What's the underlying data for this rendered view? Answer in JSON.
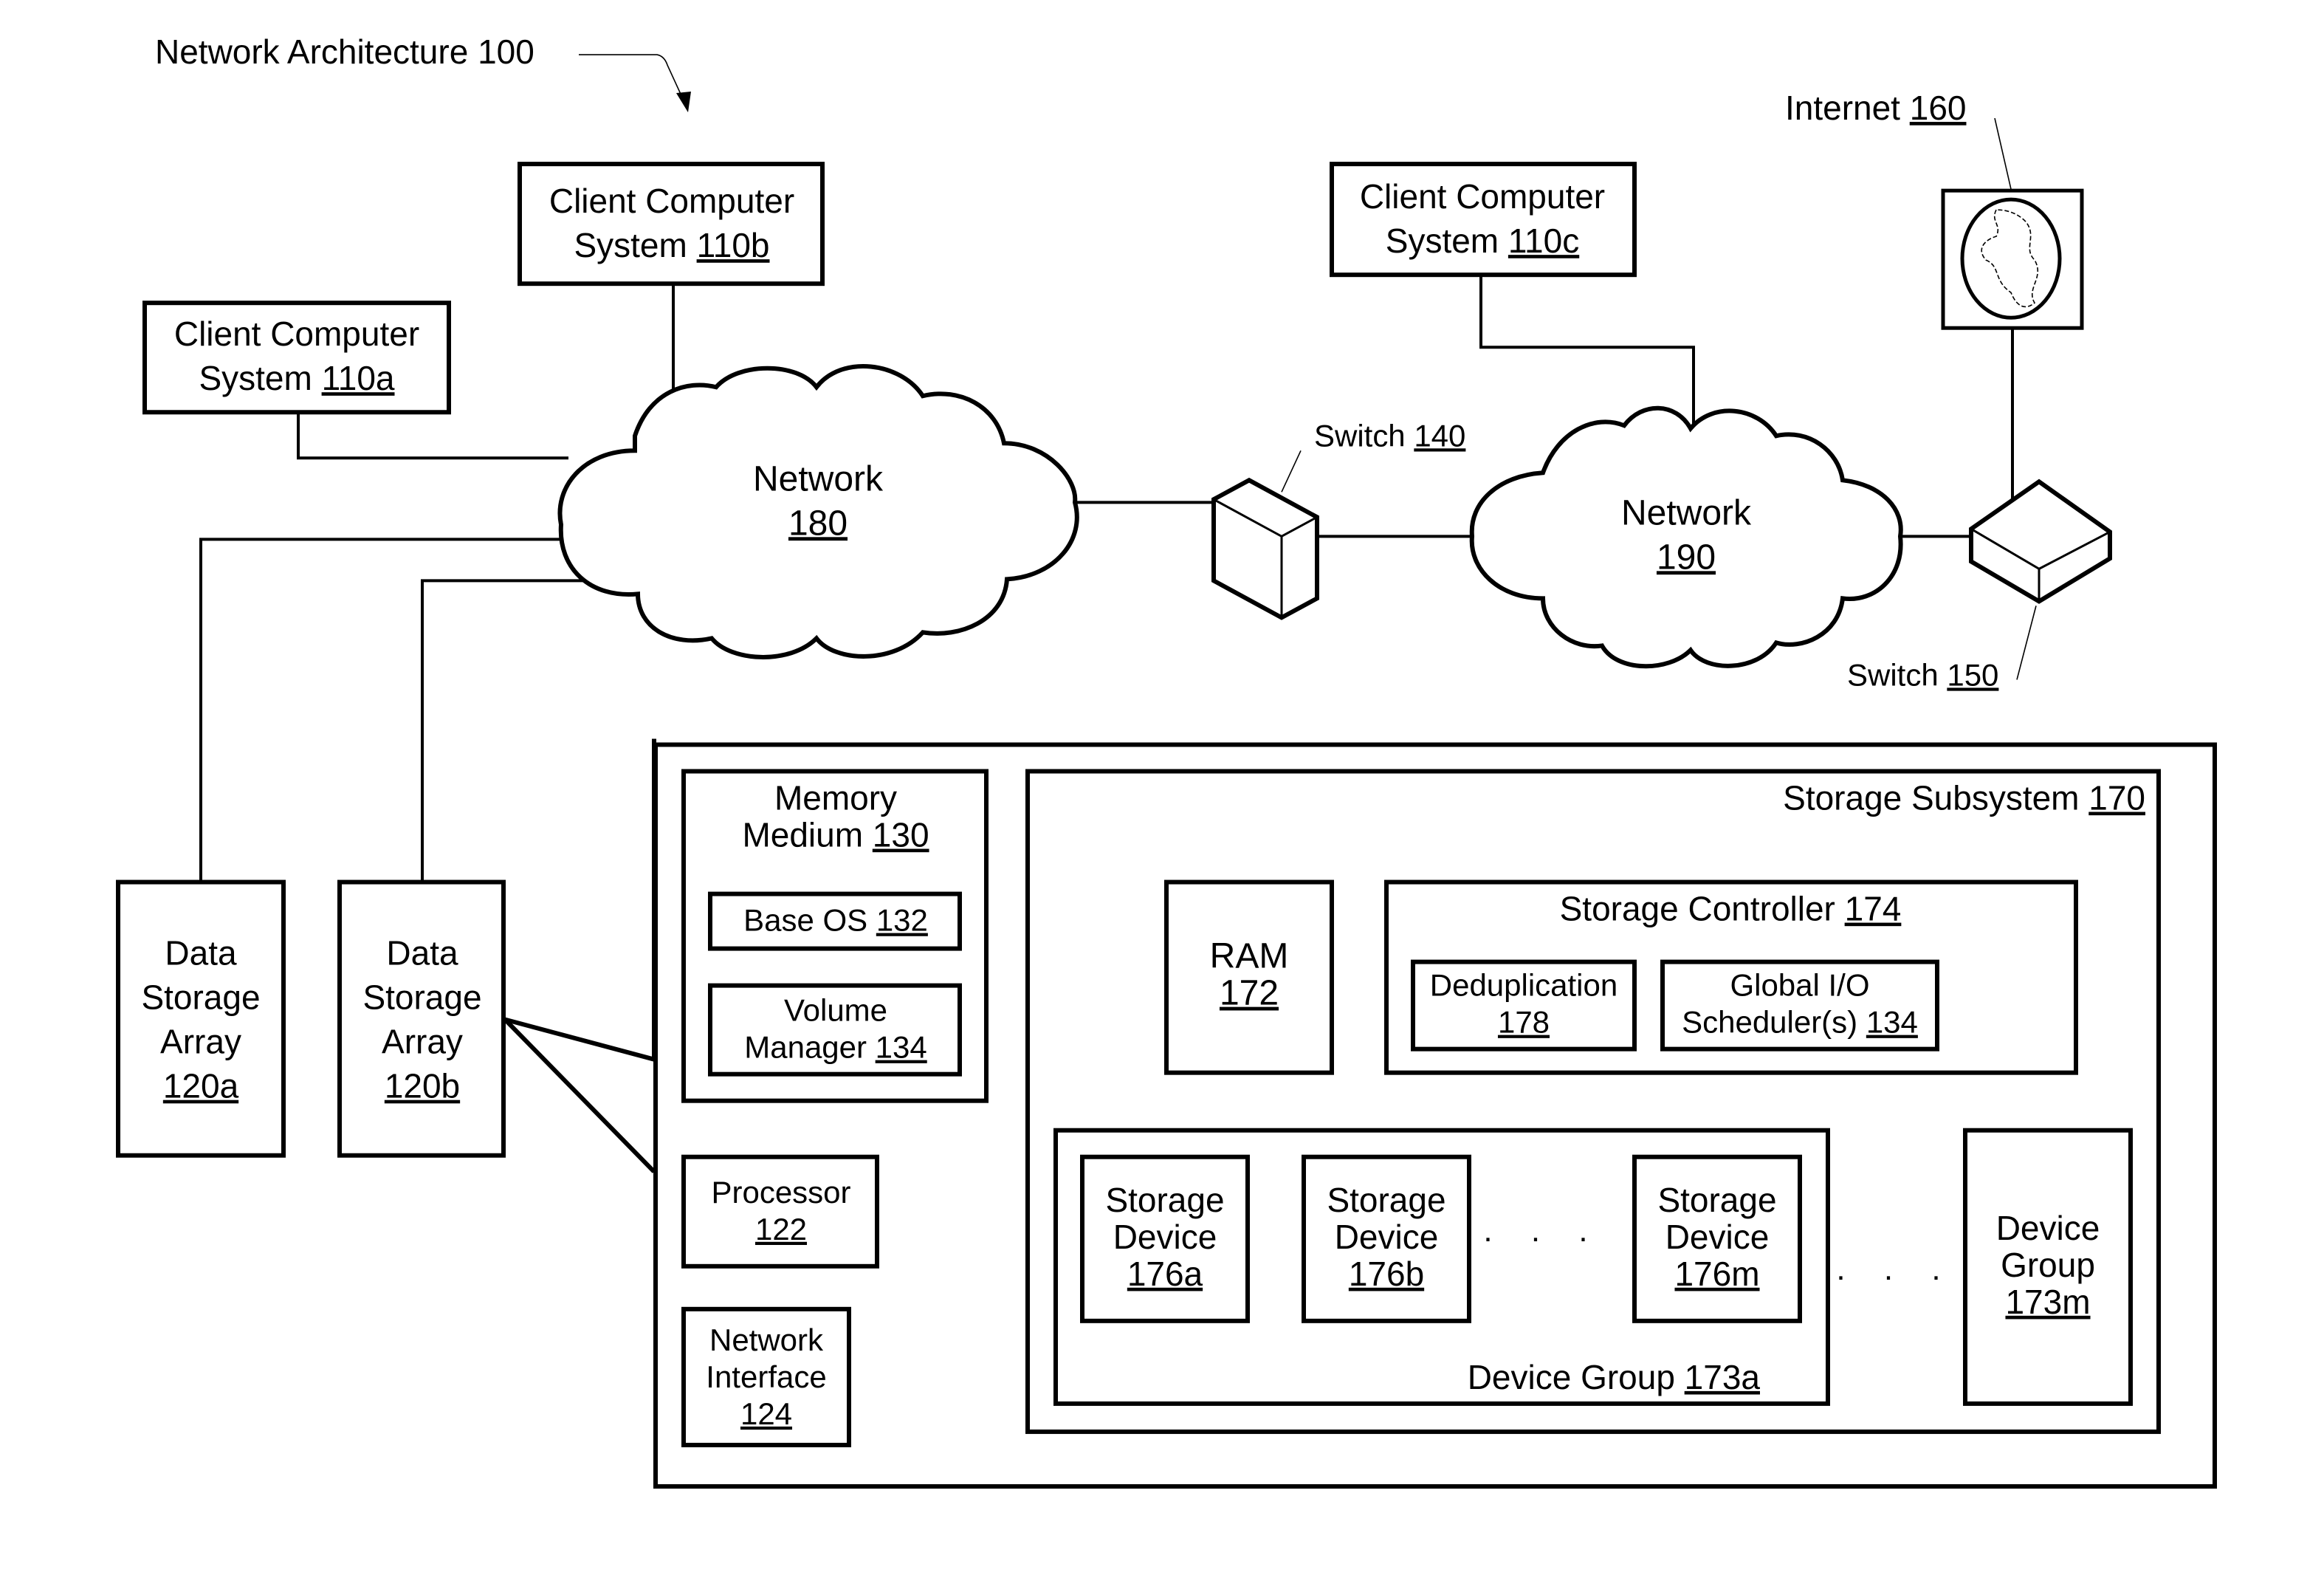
{
  "title": {
    "label": "Network Architecture",
    "ref": "100"
  },
  "clients": [
    {
      "line1": "Client Computer",
      "line2": "System",
      "ref": "110a"
    },
    {
      "line1": "Client Computer",
      "line2": "System",
      "ref": "110b"
    },
    {
      "line1": "Client Computer",
      "line2": "System",
      "ref": "110c"
    }
  ],
  "networks": [
    {
      "label": "Network",
      "ref": "180"
    },
    {
      "label": "Network",
      "ref": "190"
    }
  ],
  "switches": [
    {
      "label": "Switch",
      "ref": "140"
    },
    {
      "label": "Switch",
      "ref": "150"
    }
  ],
  "internet": {
    "label": "Internet",
    "ref": "160",
    "icon": "globe-icon"
  },
  "arrays": [
    {
      "line1": "Data",
      "line2": "Storage",
      "line3": "Array",
      "ref": "120a"
    },
    {
      "line1": "Data",
      "line2": "Storage",
      "line3": "Array",
      "ref": "120b"
    }
  ],
  "array_detail": {
    "memory_medium": {
      "line1": "Memory",
      "line2": "Medium",
      "ref": "130"
    },
    "base_os": {
      "label": "Base OS",
      "ref": "132"
    },
    "volume_manager": {
      "line1": "Volume",
      "line2": "Manager",
      "ref": "134"
    },
    "processor": {
      "label": "Processor",
      "ref": "122"
    },
    "network_interface": {
      "line1": "Network",
      "line2": "Interface",
      "ref": "124"
    }
  },
  "storage_subsystem": {
    "label": "Storage Subsystem",
    "ref": "170",
    "ram": {
      "label": "RAM",
      "ref": "172"
    },
    "controller": {
      "label": "Storage Controller",
      "ref": "174",
      "dedup": {
        "label": "Deduplication",
        "ref": "178"
      },
      "scheduler": {
        "line1": "Global I/O",
        "line2": "Scheduler(s)",
        "ref": "134"
      }
    },
    "device_group_a": {
      "label": "Device Group",
      "ref": "173a",
      "devices": [
        {
          "line1": "Storage",
          "line2": "Device",
          "ref": "176a"
        },
        {
          "line1": "Storage",
          "line2": "Device",
          "ref": "176b"
        },
        {
          "line1": "Storage",
          "line2": "Device",
          "ref": "176m"
        }
      ],
      "ellipsis": ". . ."
    },
    "group_ellipsis": ". . .",
    "device_group_m": {
      "line1": "Device",
      "line2": "Group",
      "ref": "173m"
    }
  }
}
